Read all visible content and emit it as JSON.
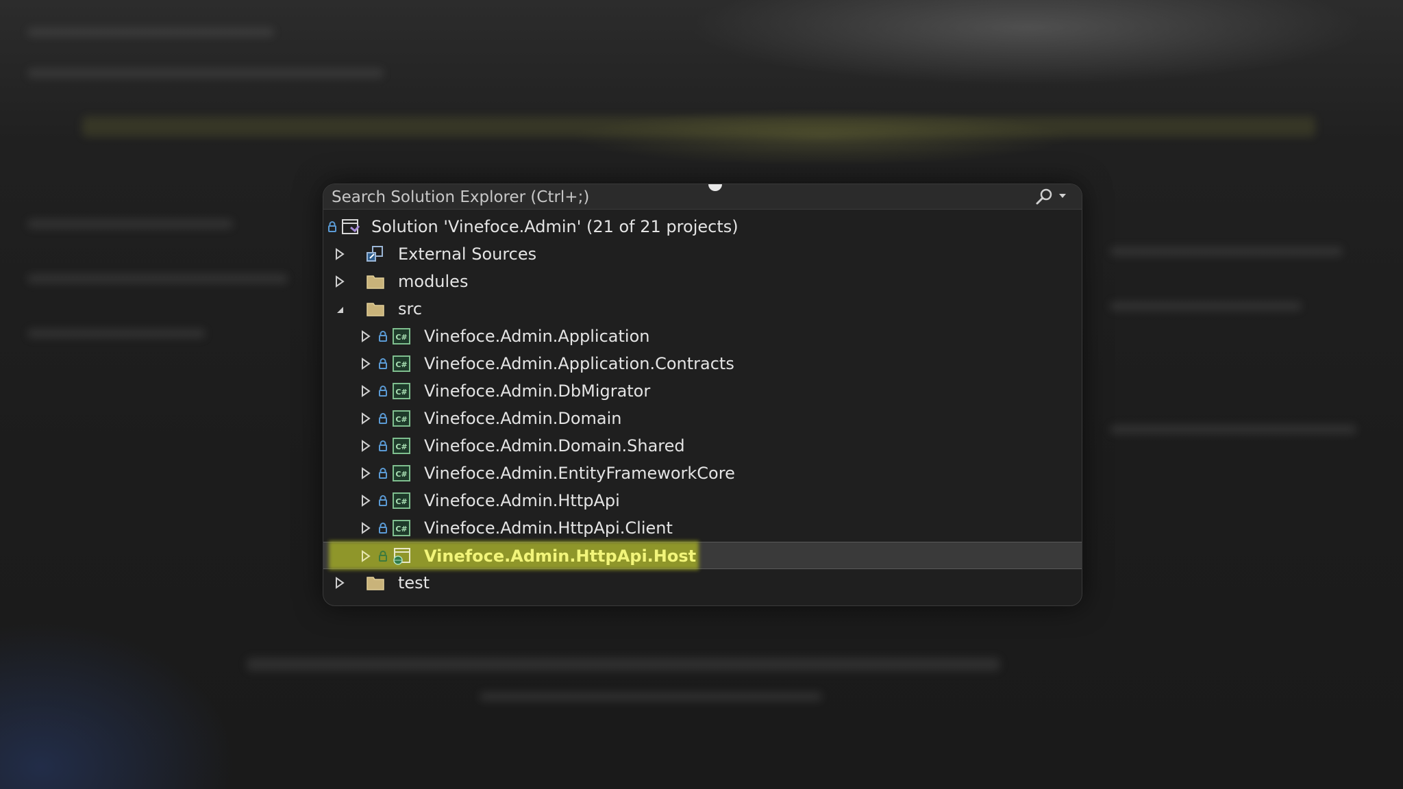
{
  "search": {
    "placeholder": "Search Solution Explorer (Ctrl+;)"
  },
  "colors": {
    "panel_bg": "#1f1f1f",
    "selection_bg": "#3a3a3a",
    "highlight": "#d6e21e",
    "lock_blue": "#5b9bd5",
    "folder": "#d8c28a"
  },
  "tree": {
    "solution": {
      "label": "Solution 'Vinefoce.Admin' (21 of 21 projects)",
      "icon": "solution-icon"
    },
    "items": [
      {
        "label": "External Sources",
        "icon": "external-sources-icon",
        "expanded": false
      },
      {
        "label": "modules",
        "icon": "folder-icon",
        "expanded": false
      },
      {
        "label": "src",
        "icon": "folder-icon",
        "expanded": true,
        "children": [
          {
            "label": "Vinefoce.Admin.Application",
            "icon": "csharp-project-icon"
          },
          {
            "label": "Vinefoce.Admin.Application.Contracts",
            "icon": "csharp-project-icon"
          },
          {
            "label": "Vinefoce.Admin.DbMigrator",
            "icon": "csharp-project-icon"
          },
          {
            "label": "Vinefoce.Admin.Domain",
            "icon": "csharp-project-icon"
          },
          {
            "label": "Vinefoce.Admin.Domain.Shared",
            "icon": "csharp-project-icon"
          },
          {
            "label": "Vinefoce.Admin.EntityFrameworkCore",
            "icon": "csharp-project-icon"
          },
          {
            "label": "Vinefoce.Admin.HttpApi",
            "icon": "csharp-project-icon"
          },
          {
            "label": "Vinefoce.Admin.HttpApi.Client",
            "icon": "csharp-project-icon"
          },
          {
            "label": "Vinefoce.Admin.HttpApi.Host",
            "icon": "web-project-icon",
            "selected": true
          }
        ]
      },
      {
        "label": "test",
        "icon": "folder-icon",
        "expanded": false
      }
    ]
  }
}
